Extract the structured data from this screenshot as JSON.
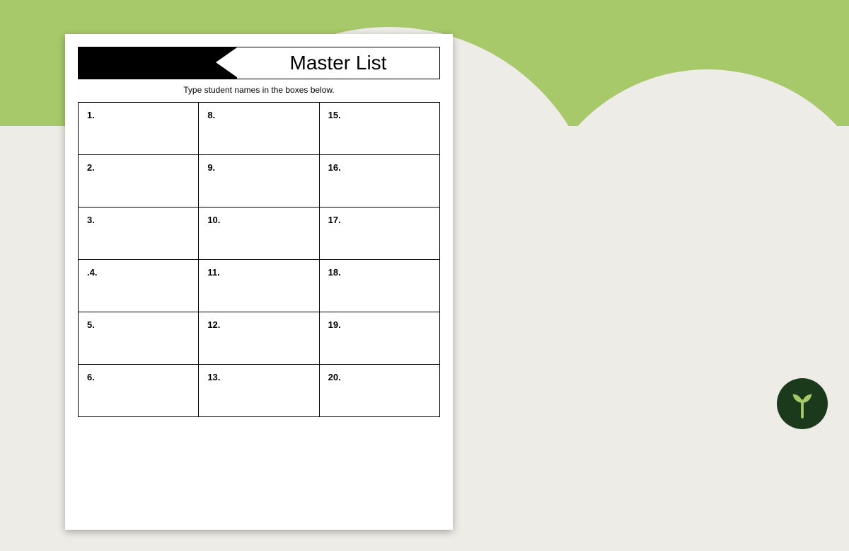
{
  "document": {
    "title": "Master List",
    "instruction": "Type student names in the boxes below.",
    "rows": [
      {
        "c1": "1.",
        "c2": "8.",
        "c3": "15."
      },
      {
        "c1": "2.",
        "c2": "9.",
        "c3": "16."
      },
      {
        "c1": "3.",
        "c2": "10.",
        "c3": "17."
      },
      {
        "c1": ".4.",
        "c2": "11.",
        "c3": "18."
      },
      {
        "c1": "5.",
        "c2": "12.",
        "c3": "19."
      },
      {
        "c1": "6.",
        "c2": "13.",
        "c3": "20."
      }
    ]
  }
}
